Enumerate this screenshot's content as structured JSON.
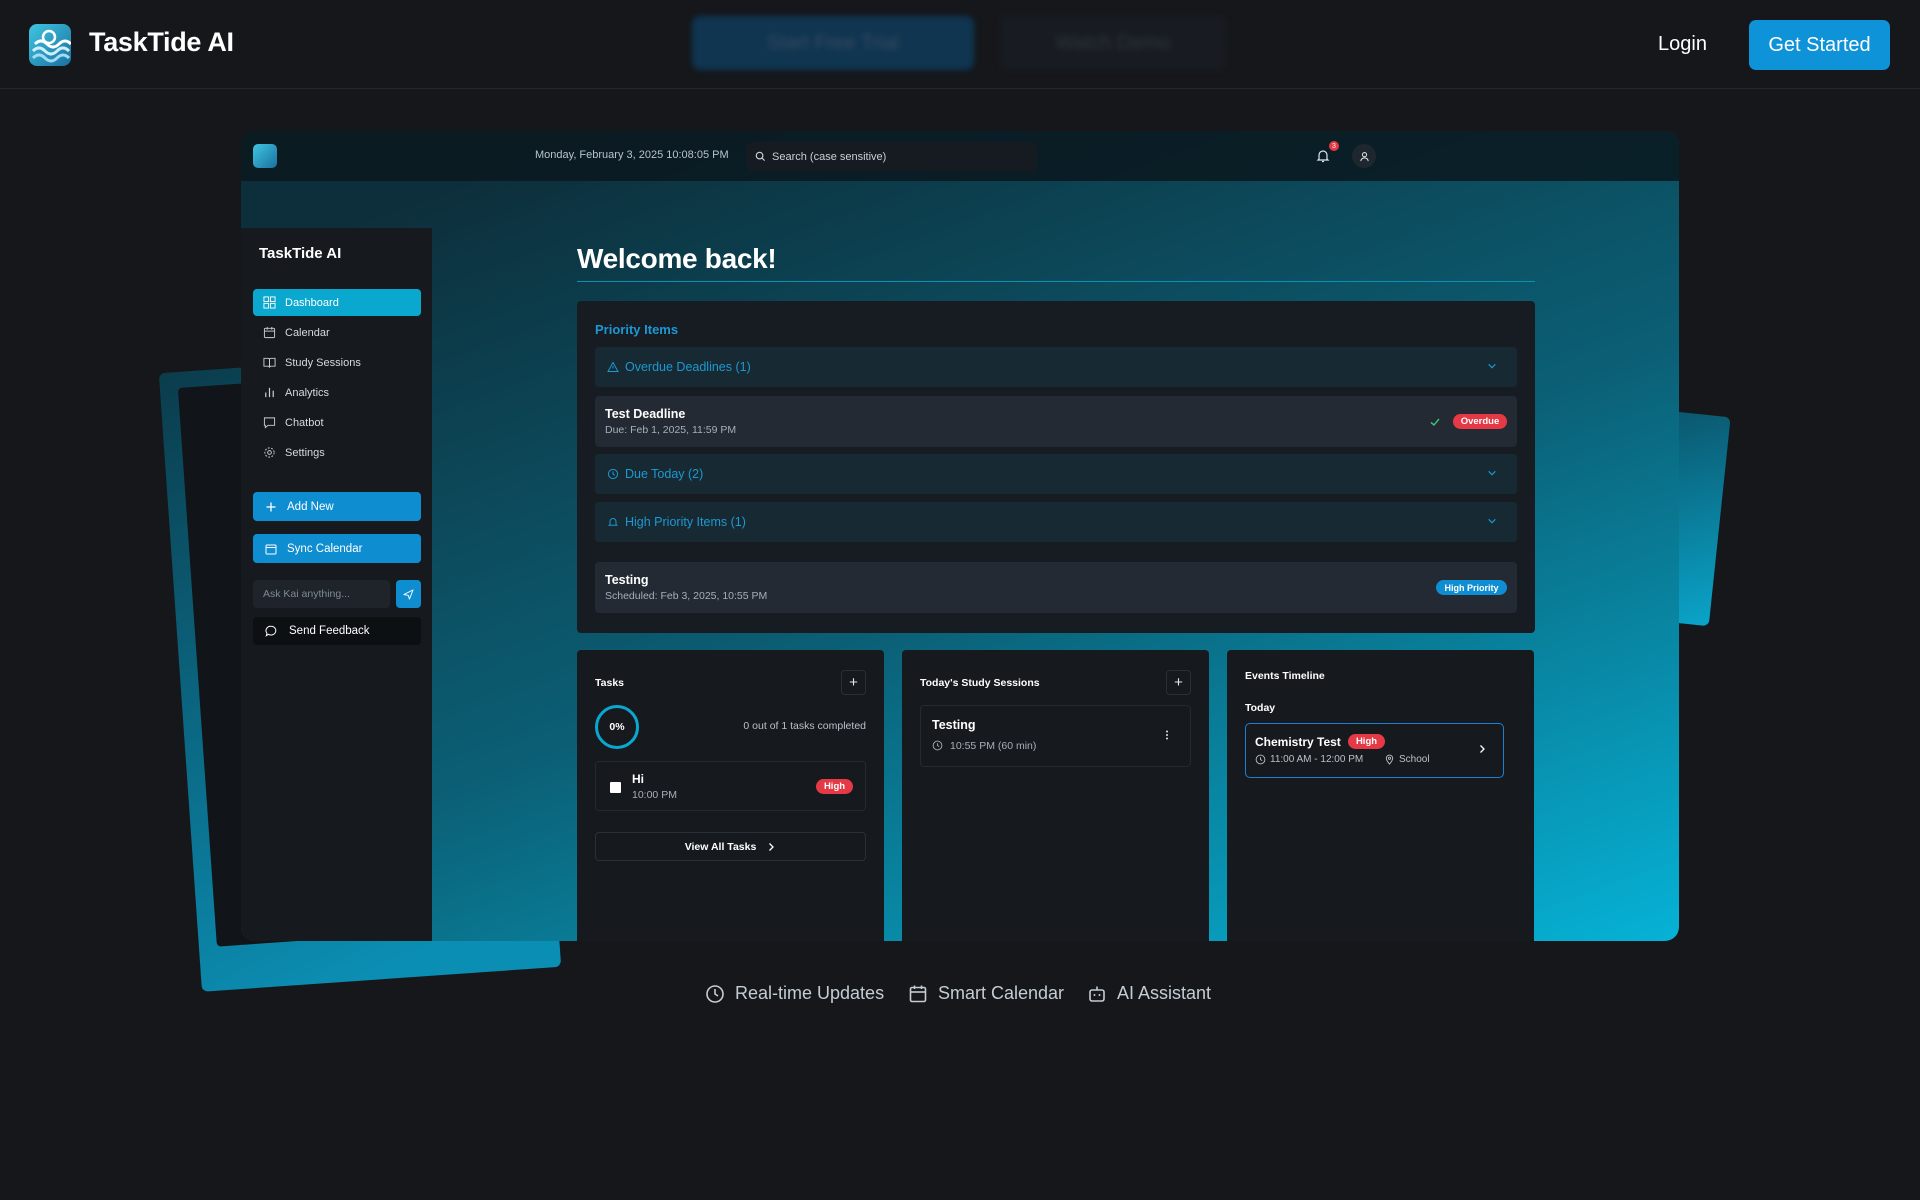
{
  "nav": {
    "brand": "TaskTide AI",
    "hero_primary": "Start Free Trial",
    "hero_secondary": "Watch Demo",
    "login": "Login",
    "get_started": "Get Started"
  },
  "app": {
    "datetime": "Monday, February 3, 2025  10:08:05 PM",
    "search_placeholder": "Search (case sensitive)",
    "notification_count": "3"
  },
  "sidebar": {
    "title": "TaskTide AI",
    "items": [
      {
        "label": "Dashboard",
        "icon": "grid-icon",
        "active": true
      },
      {
        "label": "Calendar",
        "icon": "calendar-icon"
      },
      {
        "label": "Study Sessions",
        "icon": "book-icon"
      },
      {
        "label": "Analytics",
        "icon": "bar-chart-icon"
      },
      {
        "label": "Chatbot",
        "icon": "chat-icon"
      },
      {
        "label": "Settings",
        "icon": "gear-icon"
      }
    ],
    "add_new": "Add New",
    "sync_calendar": "Sync Calendar",
    "ask_placeholder": "Ask Kai anything...",
    "send_feedback": "Send Feedback"
  },
  "main": {
    "welcome": "Welcome back!",
    "priority": {
      "title": "Priority Items",
      "overdue_header": "Overdue Deadlines (1)",
      "overdue_item": {
        "title": "Test Deadline",
        "sub": "Due: Feb 1, 2025, 11:59 PM",
        "badge": "Overdue"
      },
      "due_today_header": "Due Today (2)",
      "high_priority_header": "High Priority Items (1)",
      "high_item": {
        "title": "Testing",
        "sub": "Scheduled: Feb 3, 2025, 10:55 PM",
        "badge": "High Priority"
      }
    },
    "tasks": {
      "title": "Tasks",
      "percent": "0%",
      "progress_text": "0 out of 1 tasks completed",
      "item": {
        "title": "Hi",
        "time": "10:00 PM",
        "badge": "High"
      },
      "view_all": "View All Tasks"
    },
    "study": {
      "title": "Today's Study Sessions",
      "item": {
        "title": "Testing",
        "time": "10:55 PM (60 min)"
      }
    },
    "events": {
      "title": "Events Timeline",
      "day": "Today",
      "item": {
        "title": "Chemistry Test",
        "badge": "High",
        "time": "11:00 AM - 12:00 PM",
        "location": "School"
      }
    }
  },
  "features": [
    "Real-time Updates",
    "Smart Calendar",
    "AI Assistant"
  ],
  "colors": {
    "accent": "#0aa8cf",
    "button": "#0e93d9",
    "danger": "#e63946",
    "background": "#15171b"
  }
}
